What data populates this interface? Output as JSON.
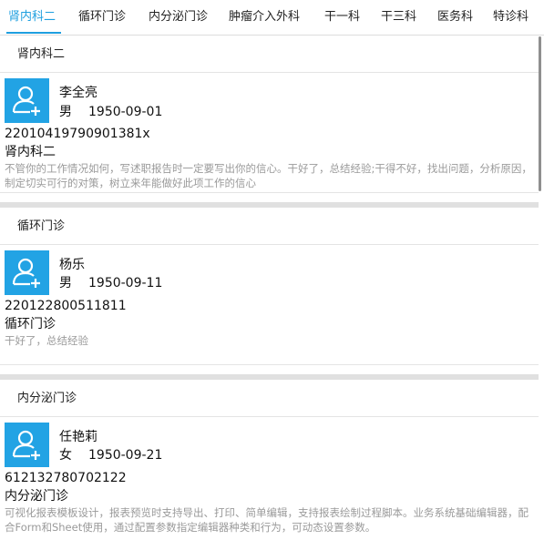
{
  "tabs": [
    {
      "label": "肾内科二",
      "active": true
    },
    {
      "label": "循环门诊",
      "active": false
    },
    {
      "label": "内分泌门诊",
      "active": false
    },
    {
      "label": "肿瘤介入外科",
      "active": false
    },
    {
      "label": "干一科",
      "active": false
    },
    {
      "label": "干三科",
      "active": false
    },
    {
      "label": "医务科",
      "active": false
    },
    {
      "label": "特诊科",
      "active": false
    }
  ],
  "colors": {
    "accent": "#1e9fdf",
    "avatar_bg": "#22a3e4",
    "muted_text": "#9a9a9a"
  },
  "sections": [
    {
      "header": "肾内科二",
      "patient": {
        "name": "李全亮",
        "gender": "男",
        "birth_date": "1950-09-01",
        "id_number": "22010419790901381x",
        "department": "肾内科二",
        "note": "不管你的工作情况如何，写述职报告时一定要写出你的信心。干好了，总结经验;干得不好，找出问题，分析原因，制定切实可行的对策，树立来年能做好此项工作的信心",
        "avatar_icon": "add-user-icon"
      }
    },
    {
      "header": "循环门诊",
      "patient": {
        "name": "杨乐",
        "gender": "男",
        "birth_date": "1950-09-11",
        "id_number": "220122800511811",
        "department": "循环门诊",
        "note": "干好了，总结经验",
        "avatar_icon": "add-user-icon"
      }
    },
    {
      "header": "内分泌门诊",
      "patient": {
        "name": "任艳莉",
        "gender": "女",
        "birth_date": "1950-09-21",
        "id_number": "612132780702122",
        "department": "内分泌门诊",
        "note": "可视化报表模板设计，报表预览时支持导出、打印、简单编辑，支持报表绘制过程脚本。业务系统基础编辑器，配合Form和Sheet使用，通过配置参数指定编辑器种类和行为，可动态设置参数。",
        "avatar_icon": "add-user-icon"
      }
    }
  ]
}
